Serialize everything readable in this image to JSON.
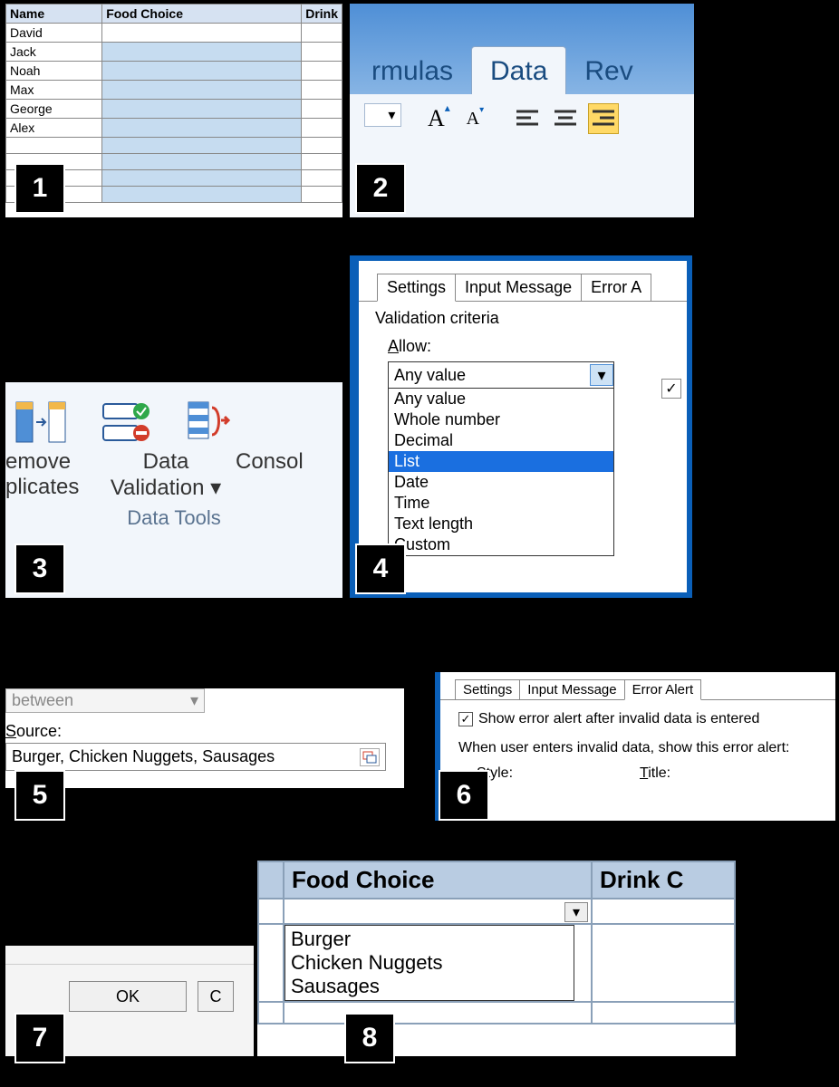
{
  "panel1": {
    "headers": [
      "Name",
      "Food Choice",
      "Drink"
    ],
    "names": [
      "David",
      "Jack",
      "Noah",
      "Max",
      "George",
      "Alex"
    ]
  },
  "panel2": {
    "tabs": {
      "formulas": "rmulas",
      "data": "Data",
      "review": "Rev"
    }
  },
  "panel3": {
    "remove": "emove",
    "duplicates": "plicates",
    "validation1": "Data",
    "validation2": "Validation",
    "consolidate": "Consol",
    "group": "Data Tools"
  },
  "panel4": {
    "tabs": {
      "settings": "Settings",
      "input": "Input Message",
      "error": "Error A"
    },
    "criteria_label": "Validation criteria",
    "allow_label": "Allow:",
    "selected": "Any value",
    "options": [
      "Any value",
      "Whole number",
      "Decimal",
      "List",
      "Date",
      "Time",
      "Text length",
      "Custom"
    ],
    "highlight": "List"
  },
  "panel5": {
    "between": "between",
    "source_label": "Source:",
    "source_value": "Burger, Chicken Nuggets, Sausages"
  },
  "panel6": {
    "tabs": {
      "settings": "Settings",
      "input": "Input Message",
      "error": "Error Alert"
    },
    "check_label": "Show error alert after invalid data is entered",
    "note": "When user enters invalid data, show this error alert:",
    "style_label": "Style:",
    "title_label": "Title:"
  },
  "panel7": {
    "ok": "OK",
    "cancel": "C"
  },
  "panel8": {
    "headers": [
      "Food Choice",
      "Drink C"
    ],
    "dropdown": [
      "Burger",
      "Chicken Nuggets",
      "Sausages"
    ]
  },
  "numbers": [
    "1",
    "2",
    "3",
    "4",
    "5",
    "6",
    "7",
    "8"
  ]
}
